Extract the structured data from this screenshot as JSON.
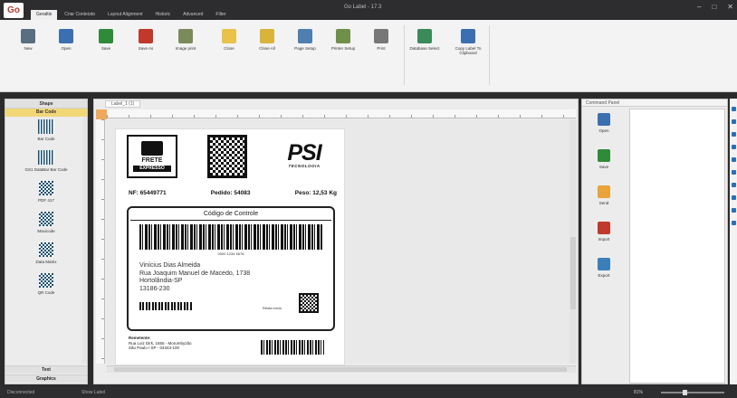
{
  "app": {
    "logo_text": "Go",
    "window_title": "Go Label - 17.3"
  },
  "tabs": [
    {
      "label": "Geraltis",
      "active": true
    },
    {
      "label": "Criar Conteúdo",
      "active": false
    },
    {
      "label": "Layout Alignment",
      "active": false
    },
    {
      "label": "Historic",
      "active": false
    },
    {
      "label": "Advanced",
      "active": false
    },
    {
      "label": "Filter",
      "active": false
    }
  ],
  "ribbon": {
    "buttons": [
      {
        "label": "New",
        "color": "#5a6e82"
      },
      {
        "label": "Open",
        "color": "#3b6fb0"
      },
      {
        "label": "Save",
        "color": "#2f8a3a"
      },
      {
        "label": "Save As",
        "color": "#c0392b"
      },
      {
        "label": "Image print",
        "color": "#7a8a5a"
      },
      {
        "label": "Close",
        "color": "#e8c24a"
      },
      {
        "label": "Close All",
        "color": "#d9b33a"
      },
      {
        "label": "Page Setup",
        "color": "#4f7fb0"
      },
      {
        "label": "Printer Setup",
        "color": "#6f8f4a"
      },
      {
        "label": "Print",
        "color": "#777777"
      },
      {
        "label": "Database Select",
        "color": "#3a8a5a"
      },
      {
        "label": "Copy Label To Clipboard",
        "color": "#3b6fb0"
      }
    ]
  },
  "left_panel": {
    "header": "Shape",
    "subheader": "Bar Code",
    "items": [
      {
        "label": "Bar Code",
        "icon": "barcode-icon"
      },
      {
        "label": "GS1 DataBar Bar Code",
        "icon": "gs1-barcode-icon"
      },
      {
        "label": "PDF 417",
        "icon": "pdf417-icon"
      },
      {
        "label": "Maxicode",
        "icon": "maxicode-icon"
      },
      {
        "label": "Data Matrix",
        "icon": "datamatrix-icon"
      },
      {
        "label": "QR Code",
        "icon": "qrcode-icon"
      }
    ],
    "footer1": "Text",
    "footer2": "Graphics"
  },
  "document_tab": "Label_1 (1)",
  "label": {
    "frete": "FRETE",
    "expresso": "EXPRESSO",
    "brand_big": "PSI",
    "brand_small": "TECNOLOGIA",
    "nf": "NF: 65449771",
    "pedido": "Pedido: 54083",
    "peso": "Peso: 12,53 Kg",
    "control_title": "Código de Controle",
    "barcode_number": "0000 1234 5678",
    "recipient_name": "Vinícius Dias Almeida",
    "recipient_street": "Rua Joaquim Manuel de Macedo, 1738",
    "recipient_city": "Hortolândia-SP",
    "recipient_zip": "13186-230",
    "resta_text": "Resta envio",
    "sender_head": "Remetente:",
    "sender_line1": "Rua Luiz Dirk, 1655 - Morumbyzão",
    "sender_line2": "São Paulo / SP - 04343-100"
  },
  "command_panel": {
    "header": "Command Panel",
    "items": [
      {
        "label": "Open",
        "color": "#3b6fb0"
      },
      {
        "label": "Save",
        "color": "#2f8a3a"
      },
      {
        "label": "Send",
        "color": "#e8a33a"
      },
      {
        "label": "Import",
        "color": "#c0392b"
      },
      {
        "label": "Export",
        "color": "#3a7fb8"
      }
    ]
  },
  "status": {
    "left": "Disconnected",
    "page": "Show Label",
    "zoom": "81%"
  }
}
